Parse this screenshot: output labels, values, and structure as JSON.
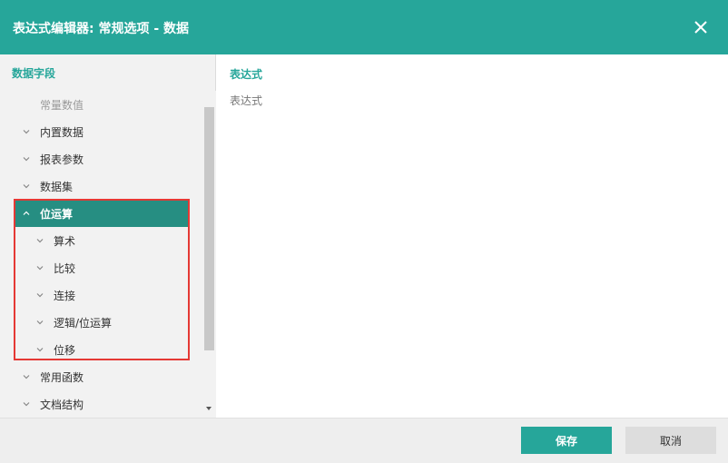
{
  "dialog": {
    "title": "表达式编辑器: 常规选项 - 数据"
  },
  "left_panel": {
    "section_title": "数据字段",
    "items": [
      {
        "label": "常量数值",
        "state": "disabled"
      },
      {
        "label": "内置数据",
        "state": "collapsed"
      },
      {
        "label": "报表参数",
        "state": "collapsed"
      },
      {
        "label": "数据集",
        "state": "collapsed"
      },
      {
        "label": "位运算",
        "state": "expanded-selected"
      },
      {
        "label": "算术",
        "state": "collapsed"
      },
      {
        "label": "比较",
        "state": "collapsed"
      },
      {
        "label": "连接",
        "state": "collapsed"
      },
      {
        "label": "逻辑/位运算",
        "state": "collapsed"
      },
      {
        "label": "位移",
        "state": "collapsed"
      },
      {
        "label": "常用函数",
        "state": "collapsed"
      },
      {
        "label": "文档结构",
        "state": "collapsed"
      }
    ]
  },
  "right_panel": {
    "label": "表达式",
    "placeholder": "表达式"
  },
  "footer": {
    "save_label": "保存",
    "cancel_label": "取消"
  },
  "colors": {
    "accent": "#26a69a",
    "selected": "#268e82",
    "highlight_box": "#e53935"
  }
}
